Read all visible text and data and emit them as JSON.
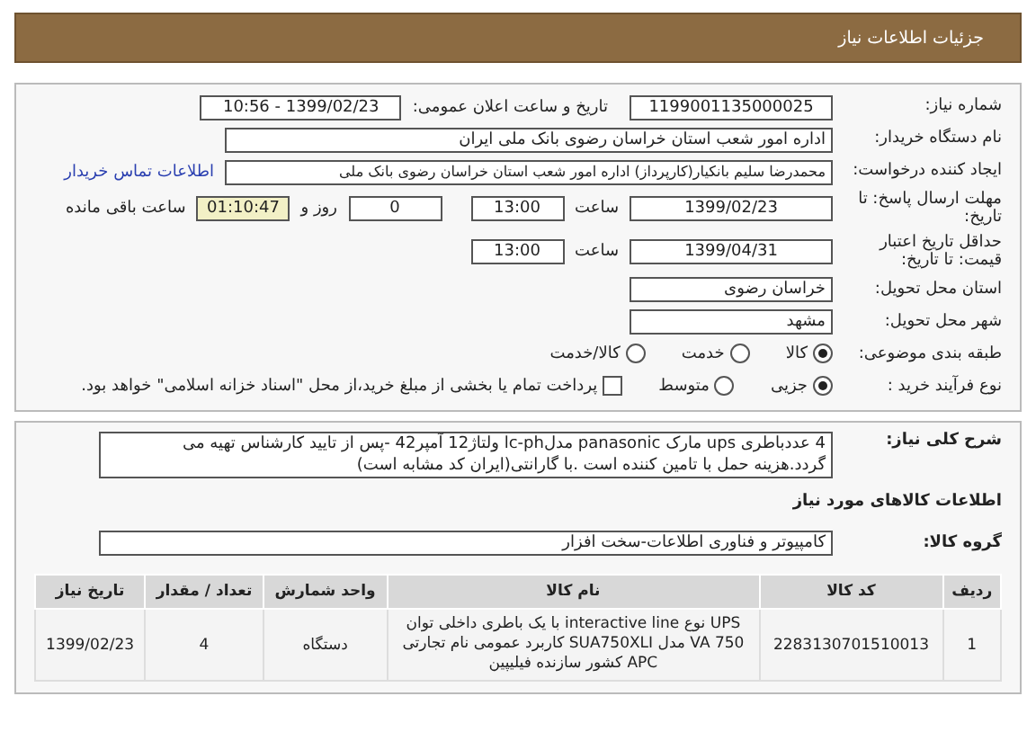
{
  "header": {
    "title": "جزئیات اطلاعات نیاز"
  },
  "need_number": {
    "label": "شماره نیاز:",
    "value": "1199001135000025"
  },
  "announce": {
    "label": "تاریخ و ساعت اعلان عمومی:",
    "value": "1399/02/23 - 10:56"
  },
  "buyer": {
    "label": "نام دستگاه خریدار:",
    "value": "اداره امور شعب استان خراسان رضوی بانک ملی ایران"
  },
  "creator": {
    "label": "ایجاد کننده درخواست:",
    "value": "محمدرضا سلیم  بانکیار(کارپرداز) اداره امور شعب استان خراسان رضوی بانک ملی",
    "link": "اطلاعات تماس خریدار"
  },
  "deadline": {
    "label": "مهلت ارسال پاسخ: تا تاریخ:",
    "date": "1399/02/23",
    "time_label": "ساعت",
    "time": "13:00",
    "days": "0",
    "days_label": "روز و",
    "remaining": "01:10:47",
    "remaining_label": "ساعت باقی مانده"
  },
  "validity": {
    "label": "حداقل تاریخ اعتبار قیمت: تا تاریخ:",
    "date": "1399/04/31",
    "time_label": "ساعت",
    "time": "13:00"
  },
  "province": {
    "label": "استان محل تحویل:",
    "value": "خراسان رضوی"
  },
  "city": {
    "label": "شهر محل تحویل:",
    "value": "مشهد"
  },
  "category": {
    "label": "طبقه بندی موضوعی:",
    "options": [
      {
        "label": "کالا",
        "selected": true
      },
      {
        "label": "خدمت",
        "selected": false
      },
      {
        "label": "کالا/خدمت",
        "selected": false
      }
    ]
  },
  "process": {
    "label": "نوع فرآیند خرید :",
    "options": [
      {
        "label": "جزیی",
        "selected": true
      },
      {
        "label": "متوسط",
        "selected": false
      }
    ],
    "treasury": {
      "checked": false,
      "label": "پرداخت تمام یا بخشی از مبلغ خرید،از محل \"اسناد خزانه اسلامی\" خواهد بود."
    }
  },
  "description": {
    "label": "شرح کلی نیاز:",
    "value": "4 عددباطری ups مارک panasonic مدلlc-ph ولتاژ12 آمپر42 -پس از تایید کارشناس تهیه می گردد.هزینه حمل با تامین کننده است .با گارانتی(ایران کد مشابه است)"
  },
  "goods_title": "اطلاعات کالاهای مورد نیاز",
  "goods_group": {
    "label": "گروه کالا:",
    "value": "کامپیوتر و فناوری اطلاعات-سخت افزار"
  },
  "table": {
    "columns": [
      "ردیف",
      "کد کالا",
      "نام کالا",
      "واحد شمارش",
      "تعداد / مقدار",
      "تاریخ نیاز"
    ],
    "rows": [
      [
        "1",
        "2283130701510013",
        "UPS نوع interactive line با یک باطری داخلی توان 750 VA مدل SUA750XLI کاربرد عمومی نام تجارتی APC کشور سازنده فیلیپین",
        "دستگاه",
        "4",
        "1399/02/23"
      ]
    ]
  }
}
